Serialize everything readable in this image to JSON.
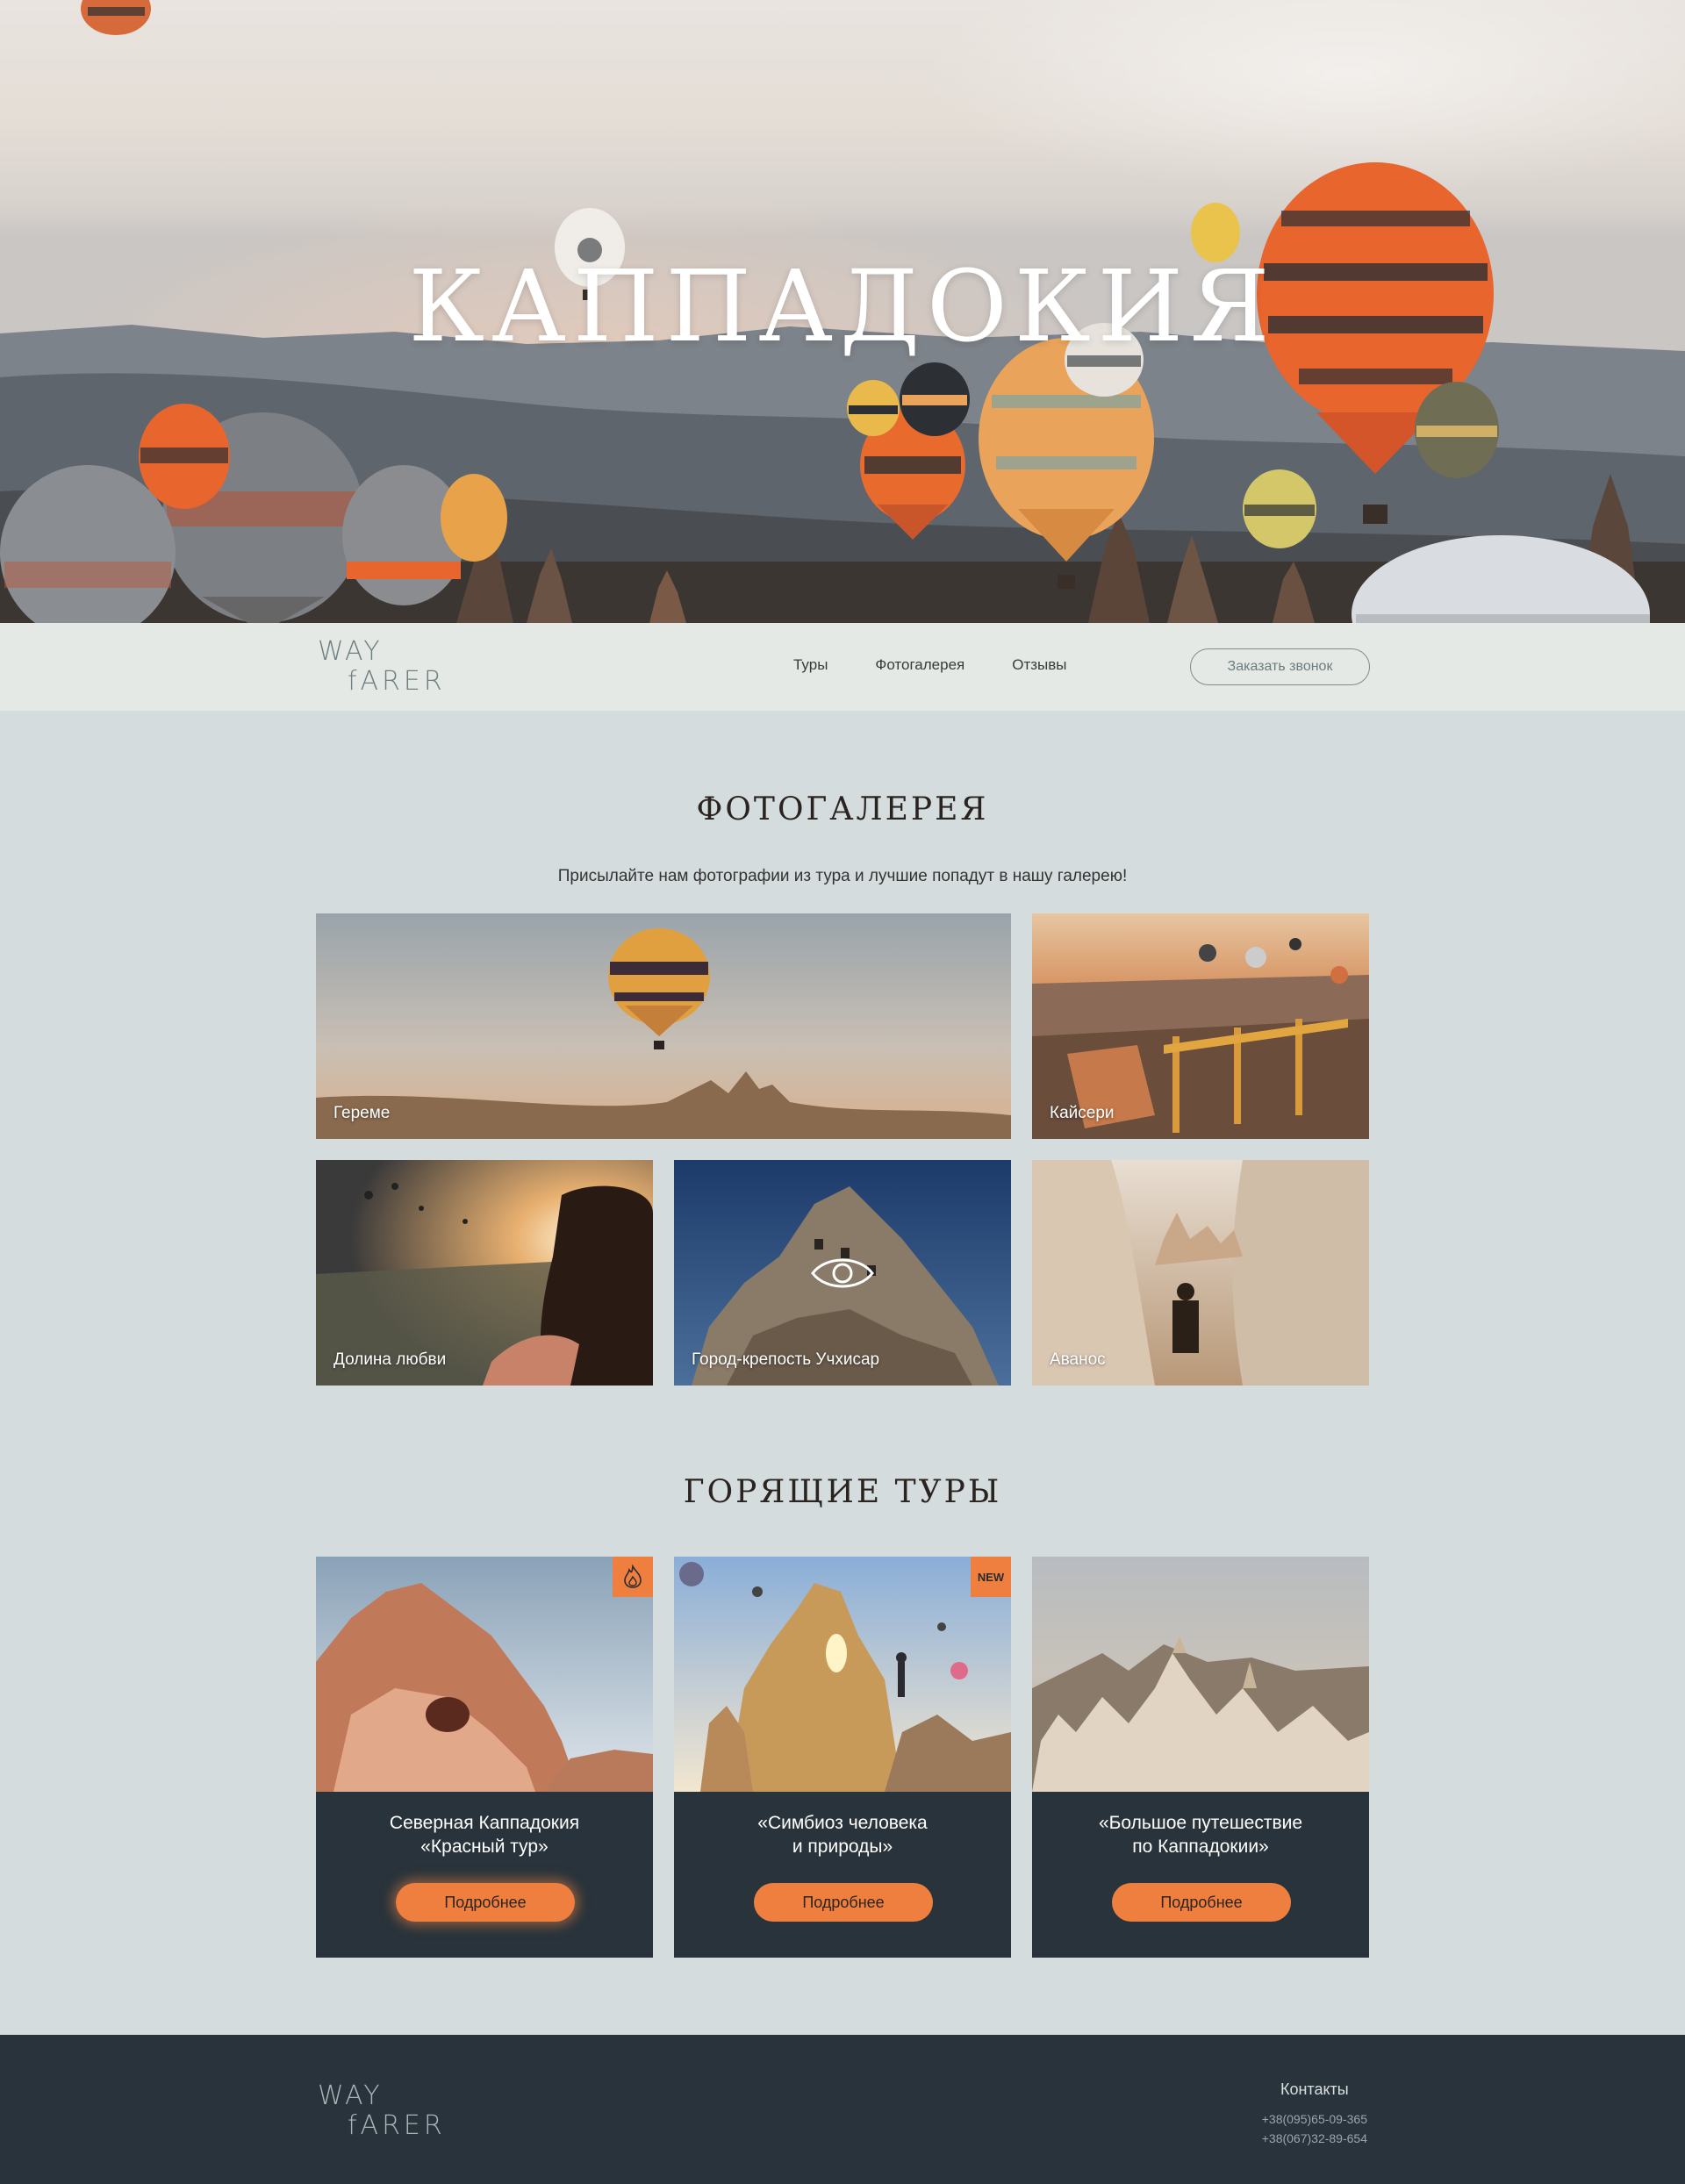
{
  "hero": {
    "title": "КАППАДОКИЯ"
  },
  "nav": {
    "logo_line1": "WAY",
    "logo_line2": "fARER",
    "links": [
      "Туры",
      "Фотогалерея",
      "Отзывы"
    ],
    "call_button": "Заказать звонок"
  },
  "gallery": {
    "title": "ФОТОГАЛЕРЕЯ",
    "subtitle": "Присылайте нам фотографии из тура и лучшие попадут в нашу галерею!",
    "items": [
      "Гереме",
      "Кайсери",
      "Долина любви",
      "Город-крепость Учхисар",
      "Аванос"
    ]
  },
  "tours": {
    "title": "ГОРЯЩИЕ ТУРЫ",
    "cards": [
      {
        "title": "Северная Каппадокия\n«Красный тур»",
        "button": "Подробнее",
        "badge": "fire-icon"
      },
      {
        "title": "«Симбиоз человека\nи природы»",
        "button": "Подробнее",
        "badge": "NEW"
      },
      {
        "title": "«Большое путешествие\nпо Каппадокии»",
        "button": "Подробнее",
        "badge": ""
      }
    ]
  },
  "footer": {
    "logo_line1": "WAY",
    "logo_line2": "fARER",
    "contacts_title": "Контакты",
    "phone1": "+38(095)65-09-365",
    "phone2": "+38(067)32-89-654"
  },
  "colors": {
    "accent": "#ef7f3f",
    "dark": "#28333b",
    "background": "#d5dcdd",
    "nav_bg": "#e4e9e6"
  }
}
